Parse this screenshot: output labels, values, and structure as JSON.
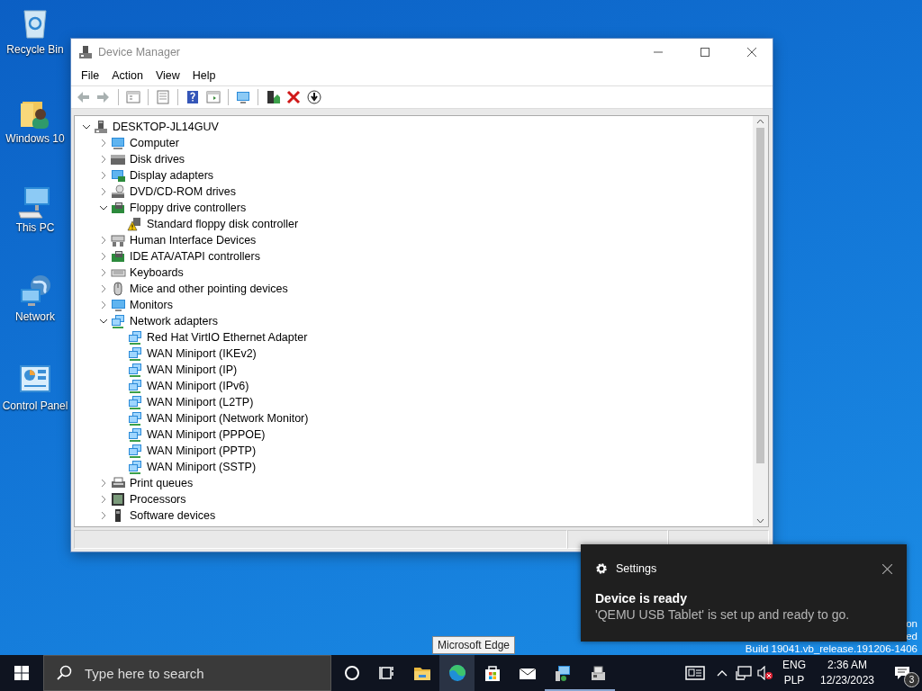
{
  "desktop_icons": [
    {
      "label": "Recycle Bin",
      "kind": "recycle-bin"
    },
    {
      "label": "Windows 10",
      "kind": "user-folder"
    },
    {
      "label": "This PC",
      "kind": "pc"
    },
    {
      "label": "Network",
      "kind": "network"
    },
    {
      "label": "Control Panel",
      "kind": "control-panel"
    }
  ],
  "build_info": [
    "on",
    "ed",
    "Build 19041.vb_release.191206-1406"
  ],
  "window": {
    "title": "Device Manager",
    "menu": [
      "File",
      "Action",
      "View",
      "Help"
    ],
    "toolbar": [
      {
        "kind": "back",
        "disabled": true
      },
      {
        "kind": "forward",
        "disabled": true
      },
      {
        "kind": "separator"
      },
      {
        "kind": "console-tree",
        "disabled": false
      },
      {
        "kind": "separator"
      },
      {
        "kind": "properties",
        "disabled": false
      },
      {
        "kind": "separator"
      },
      {
        "kind": "help",
        "disabled": false
      },
      {
        "kind": "action-pane",
        "disabled": false
      },
      {
        "kind": "separator"
      },
      {
        "kind": "scan",
        "disabled": false
      },
      {
        "kind": "separator"
      },
      {
        "kind": "update",
        "disabled": false
      },
      {
        "kind": "uninstall",
        "disabled": false
      },
      {
        "kind": "enable",
        "disabled": false
      }
    ],
    "tree": {
      "label": "DESKTOP-JL14GUV",
      "kind": "root",
      "expanded": true,
      "children": [
        {
          "label": "Computer",
          "kind": "computer",
          "expanded": false
        },
        {
          "label": "Disk drives",
          "kind": "disk",
          "expanded": false
        },
        {
          "label": "Display adapters",
          "kind": "display",
          "expanded": false
        },
        {
          "label": "DVD/CD-ROM drives",
          "kind": "dvd",
          "expanded": false
        },
        {
          "label": "Floppy drive controllers",
          "kind": "board",
          "expanded": true,
          "children": [
            {
              "label": "Standard floppy disk controller",
              "kind": "warning"
            }
          ]
        },
        {
          "label": "Human Interface Devices",
          "kind": "hid",
          "expanded": false
        },
        {
          "label": "IDE ATA/ATAPI controllers",
          "kind": "board",
          "expanded": false
        },
        {
          "label": "Keyboards",
          "kind": "keyboard",
          "expanded": false
        },
        {
          "label": "Mice and other pointing devices",
          "kind": "mouse",
          "expanded": false
        },
        {
          "label": "Monitors",
          "kind": "monitor",
          "expanded": false
        },
        {
          "label": "Network adapters",
          "kind": "network",
          "expanded": true,
          "children": [
            {
              "label": "Red Hat VirtIO Ethernet Adapter",
              "kind": "network"
            },
            {
              "label": "WAN Miniport (IKEv2)",
              "kind": "network"
            },
            {
              "label": "WAN Miniport (IP)",
              "kind": "network"
            },
            {
              "label": "WAN Miniport (IPv6)",
              "kind": "network"
            },
            {
              "label": "WAN Miniport (L2TP)",
              "kind": "network"
            },
            {
              "label": "WAN Miniport (Network Monitor)",
              "kind": "network"
            },
            {
              "label": "WAN Miniport (PPPOE)",
              "kind": "network"
            },
            {
              "label": "WAN Miniport (PPTP)",
              "kind": "network"
            },
            {
              "label": "WAN Miniport (SSTP)",
              "kind": "network"
            }
          ]
        },
        {
          "label": "Print queues",
          "kind": "printer",
          "expanded": false
        },
        {
          "label": "Processors",
          "kind": "processor",
          "expanded": false
        },
        {
          "label": "Software devices",
          "kind": "software",
          "expanded": false
        }
      ]
    }
  },
  "toast": {
    "app": "Settings",
    "title": "Device is ready",
    "body": "'QEMU USB Tablet' is set up and ready to go."
  },
  "tooltip": "Microsoft Edge",
  "taskbar": {
    "search_placeholder": "Type here to search",
    "apps": [
      {
        "kind": "cortana",
        "running": false,
        "hovered": false
      },
      {
        "kind": "task-view",
        "running": false,
        "hovered": false
      },
      {
        "kind": "explorer",
        "running": false,
        "hovered": false
      },
      {
        "kind": "edge",
        "running": false,
        "hovered": true
      },
      {
        "kind": "store",
        "running": false,
        "hovered": false
      },
      {
        "kind": "mail",
        "running": false,
        "hovered": false
      },
      {
        "kind": "control-panel",
        "running": true,
        "hovered": false
      },
      {
        "kind": "device-manager",
        "running": true,
        "hovered": false
      }
    ],
    "tray": {
      "volume_muted": true,
      "language": "ENG",
      "layout": "PLP",
      "time": "2:36 AM",
      "date": "12/23/2023",
      "notifications": "3"
    }
  }
}
